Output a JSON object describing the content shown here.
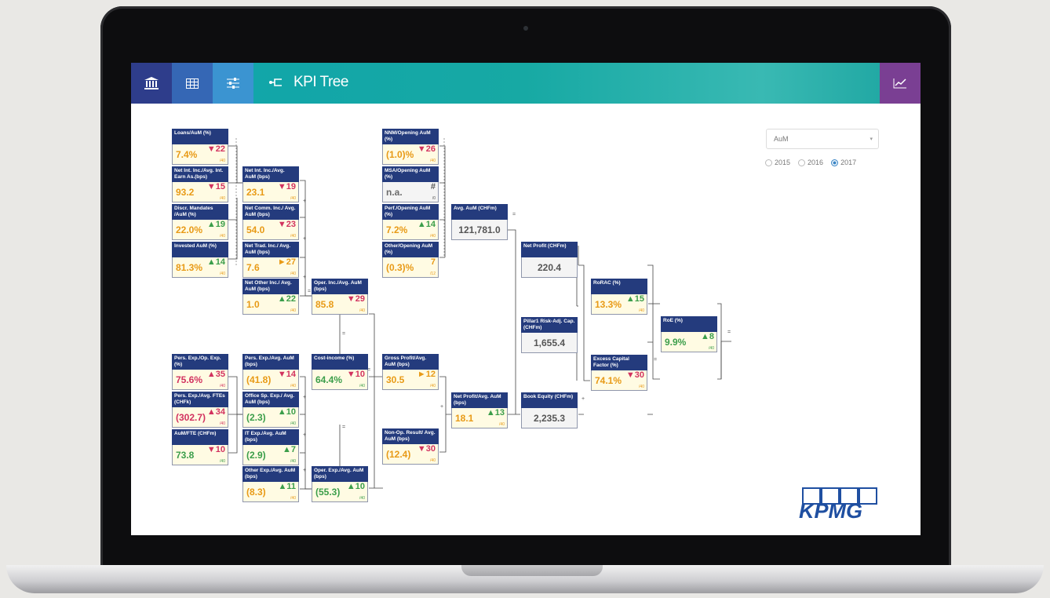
{
  "app": {
    "title": "KPI Tree",
    "nav": [
      {
        "icon": "bank-icon"
      },
      {
        "icon": "table-icon"
      },
      {
        "icon": "sliders-icon"
      }
    ],
    "right_icon": "line-chart-icon",
    "colors": {
      "nav1": "#2e3d8b",
      "nav2": "#3567b5",
      "nav3": "#3b94d1",
      "teal": "#17a9a4",
      "purple": "#7a3f93",
      "box_header": "#243b7d",
      "positive": "#3b9e4a",
      "neutral": "#e89a16",
      "negative": "#d2325f"
    }
  },
  "controls": {
    "select_value": "AuM",
    "years": [
      "2015",
      "2016",
      "2017"
    ],
    "selected_year": "2017"
  },
  "kpis": {
    "loans": {
      "label": "Loans/AuM (%)",
      "value": "7.4%",
      "rank": "▼22",
      "of": "/40"
    },
    "net_int_earn": {
      "label": "Net Int. Inc./Avg. Int. Earn As.(bps)",
      "value": "93.2",
      "rank": "▼15",
      "of": "/40"
    },
    "discr": {
      "label": "Discr. Mandates /AuM (%)",
      "value": "22.0%",
      "rank": "▲19",
      "of": "/40"
    },
    "invested": {
      "label": "Invested AuM (%)",
      "value": "81.3%",
      "rank": "▲14",
      "of": "/40"
    },
    "net_int_aum": {
      "label": "Net Int. Inc./Avg. AuM (bps)",
      "value": "23.1",
      "rank": "▼19",
      "of": "/40"
    },
    "net_comm": {
      "label": "Net Comm. Inc./ Avg. AuM (bps)",
      "value": "54.0",
      "rank": "▼23",
      "of": "/40"
    },
    "net_trad": {
      "label": "Net Trad. Inc./ Avg. AuM (bps)",
      "value": "7.6",
      "rank": "►27",
      "of": "/40"
    },
    "net_other": {
      "label": "Net Other Inc./ Avg. AuM (bps)",
      "value": "1.0",
      "rank": "▲22",
      "of": "/40"
    },
    "oper_inc": {
      "label": "Oper. Inc./Avg. AuM (bps)",
      "value": "85.8",
      "rank": "▼29",
      "of": "/40"
    },
    "nnm": {
      "label": "NNM/Opening AuM (%)",
      "value": "(1.0)%",
      "rank": "▼26",
      "of": "/40"
    },
    "msa": {
      "label": "MSA/Opening AuM (%)",
      "value": "n.a.",
      "rank": "#",
      "of": "/0"
    },
    "perf": {
      "label": "Perf./Opening AuM (%)",
      "value": "7.2%",
      "rank": "▲14",
      "of": "/40"
    },
    "other_open": {
      "label": "Other/Opening AuM (%)",
      "value": "(0.3)%",
      "rank": "7",
      "of": "/12"
    },
    "avg_aum": {
      "label": "Avg. AuM (CHFm)",
      "value": "121,781.0"
    },
    "net_profit": {
      "label": "Net Profit (CHFm)",
      "value": "220.4"
    },
    "pillar_risk": {
      "label": "Pillar1 Risk-Adj. Cap. (CHFm)",
      "value": "1,655.4"
    },
    "book_eq": {
      "label": "Book Equity (CHFm)",
      "value": "2,235.3"
    },
    "rorac": {
      "label": "RoRAC (%)",
      "value": "13.3%",
      "rank": "▲15",
      "of": "/40"
    },
    "excess": {
      "label": "Excess Capital Factor (%)",
      "value": "74.1%",
      "rank": "▼30",
      "of": "/40"
    },
    "roe": {
      "label": "RoE (%)",
      "value": "9.9%",
      "rank": "▲8",
      "of": "/40"
    },
    "pers_op": {
      "label": "Pers. Exp./Op. Exp. (%)",
      "value": "75.6%",
      "rank": "▲35",
      "of": "/40"
    },
    "pers_fte": {
      "label": "Pers. Exp./Avg. FTEs (CHFk)",
      "value": "(302.7)",
      "rank": "▲34",
      "of": "/40"
    },
    "aum_fte": {
      "label": "AuM/FTE (CHFm)",
      "value": "73.8",
      "rank": "▼10",
      "of": "/40"
    },
    "pers_aum": {
      "label": "Pers. Exp./Avg. AuM (bps)",
      "value": "(41.8)",
      "rank": "▼14",
      "of": "/40"
    },
    "office": {
      "label": "Office Sp. Exp./ Avg. AuM (bps)",
      "value": "(2.3)",
      "rank": "▲10",
      "of": "/40"
    },
    "it": {
      "label": "IT Exp./Avg. AuM (bps)",
      "value": "(2.9)",
      "rank": "▲7",
      "of": "/40"
    },
    "other_exp": {
      "label": "Other Exp./Avg. AuM (bps)",
      "value": "(8.3)",
      "rank": "▲11",
      "of": "/40"
    },
    "cost_income": {
      "label": "Cost-income (%)",
      "value": "64.4%",
      "rank": "▼10",
      "of": "/40"
    },
    "oper_exp": {
      "label": "Oper. Exp./Avg. AuM (bps)",
      "value": "(55.3)",
      "rank": "▲10",
      "of": "/40"
    },
    "gross_profit": {
      "label": "Gross Profit/Avg. AuM (bps)",
      "value": "30.5",
      "rank": "►12",
      "of": "/40"
    },
    "non_op": {
      "label": "Non-Op. Result/ Avg. AuM (bps)",
      "value": "(12.4)",
      "rank": "▼30",
      "of": "/40"
    },
    "net_profit_aum": {
      "label": "Net Profit/Avg. AuM (bps)",
      "value": "18.1",
      "rank": "▲13",
      "of": "/40"
    }
  },
  "logo": {
    "text": "KPMG"
  }
}
